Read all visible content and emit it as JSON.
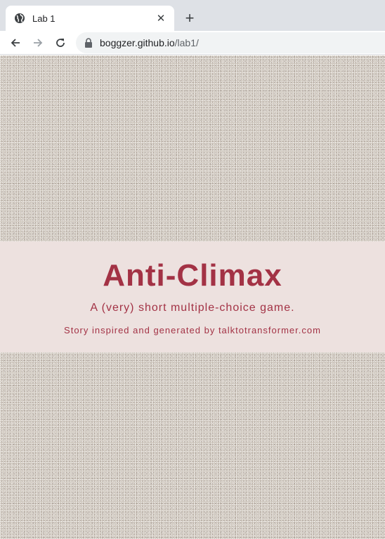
{
  "browser": {
    "tab": {
      "title": "Lab 1",
      "favicon": "globe-icon",
      "close_icon": "close-icon"
    },
    "new_tab_icon": "plus-icon",
    "toolbar": {
      "back_icon": "arrow-left-icon",
      "forward_icon": "arrow-right-icon",
      "reload_icon": "reload-icon",
      "lock_icon": "lock-icon",
      "url_host": "boggzer.github.io",
      "url_path": "/lab1/"
    }
  },
  "page": {
    "title": "Anti-Climax",
    "subtitle": "A (very) short multiple-choice game.",
    "credit": "Story inspired and generated by talktotransformer.com",
    "colors": {
      "accent": "#a33245",
      "banner_bg": "#ede1df",
      "page_bg": "#d3ccc3"
    }
  }
}
